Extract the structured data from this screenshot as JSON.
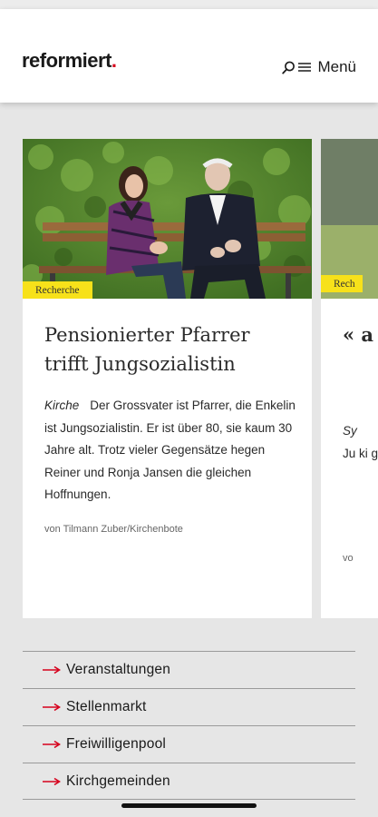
{
  "header": {
    "logo_text": "reformiert",
    "logo_dot": ".",
    "menu_label": "Menü",
    "brand_color": "#d6001c"
  },
  "cards": [
    {
      "category": "Recherche",
      "title": "Pensionierter Pfarrer trifft Jungsozialistin",
      "rubric": "Kirche",
      "teaser": "Der Grossvater ist Pfarrer, die Enkelin ist Jungsozialistin. Er ist über 80, sie kaum 30 Jahre alt. Trotz vieler Gegensätze hegen Reiner und Ronja Jansen die gleichen Hoffnungen.",
      "author": "von Tilmann Zuber/Kirchenbote"
    },
    {
      "category": "Rech",
      "title": "« a u",
      "rubric": "Sy",
      "teaser": "Ju ki gl au",
      "author": "vo"
    }
  ],
  "links": [
    {
      "label": "Veranstaltungen"
    },
    {
      "label": "Stellenmarkt"
    },
    {
      "label": "Freiwilligenpool"
    },
    {
      "label": "Kirchgemeinden"
    }
  ],
  "colors": {
    "accent_red": "#d6001c",
    "tag_yellow": "#f7e11a",
    "background": "#e6e6e6"
  }
}
